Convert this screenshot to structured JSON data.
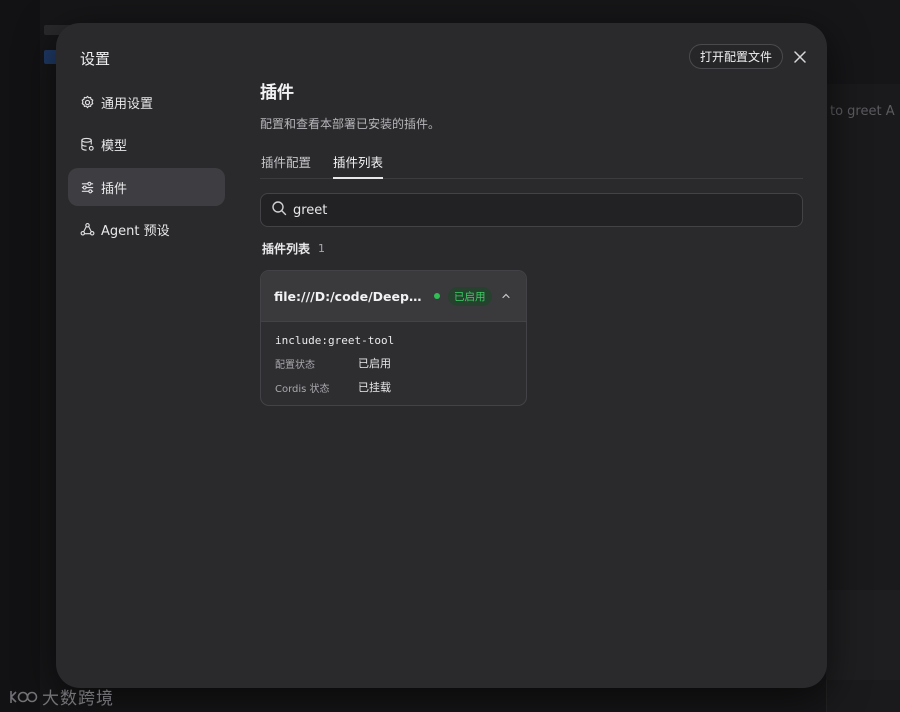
{
  "modal": {
    "title": "设置",
    "open_config_label": "打开配置文件"
  },
  "nav": {
    "items": [
      {
        "label": "通用设置",
        "icon": "gear-icon"
      },
      {
        "label": "模型",
        "icon": "database-icon"
      },
      {
        "label": "插件",
        "icon": "sliders-icon",
        "active": true
      },
      {
        "label": "Agent 预设",
        "icon": "agent-icon"
      }
    ]
  },
  "content": {
    "title": "插件",
    "description": "配置和查看本部署已安装的插件。",
    "tabs": [
      {
        "label": "插件配置"
      },
      {
        "label": "插件列表",
        "active": true
      }
    ],
    "search_value": "greet",
    "list_header": "插件列表",
    "list_count": "1"
  },
  "plugin": {
    "name": "file:///D:/code/DeepSe...",
    "status": "已启用",
    "include": "include:greet-tool",
    "config_status_label": "配置状态",
    "config_status_value": "已启用",
    "cordis_status_label": "Cordis 状态",
    "cordis_status_value": "已挂载"
  },
  "background": {
    "right_text": "to greet A"
  },
  "watermark": {
    "text": "大数跨境"
  },
  "colors": {
    "modal_bg": "#2a2a2c",
    "active_nav_bg": "#3e3e42",
    "status_green": "#3fcc66"
  }
}
